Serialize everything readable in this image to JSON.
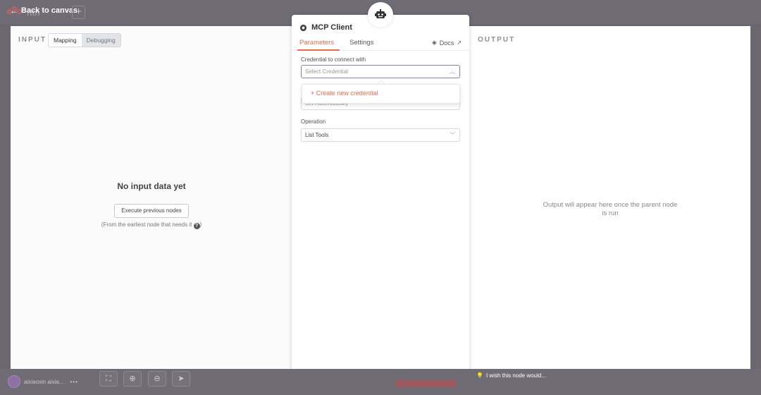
{
  "header": {
    "back_label": "Back to canvas",
    "workflow_name": "ntn"
  },
  "input_pane": {
    "label": "INPUT",
    "tabs": [
      "Mapping",
      "Debugging"
    ],
    "empty_title": "No input data yet",
    "execute_button": "Execute previous nodes",
    "hint": "(From the earliest node that needs it"
  },
  "node": {
    "title": "MCP Client",
    "icon": "robot-icon",
    "tabs": {
      "parameters": "Parameters",
      "settings": "Settings"
    },
    "docs_label": "Docs",
    "credential": {
      "label": "Credential to connect with",
      "placeholder": "Select Credential"
    },
    "dropdown": {
      "create_label": "Create new credential"
    },
    "hidden_field": {
      "value": "Set Automatically"
    },
    "operation": {
      "label": "Operation",
      "value": "List Tools"
    }
  },
  "output_pane": {
    "label": "OUTPUT",
    "message": "Output will appear here once the parent node is run"
  },
  "footer": {
    "user_name": "aixiaoxin aixia...",
    "wish_label": "I wish this node would..."
  },
  "colors": {
    "accent": "#e86c4d",
    "overlay": "#6a6770"
  }
}
